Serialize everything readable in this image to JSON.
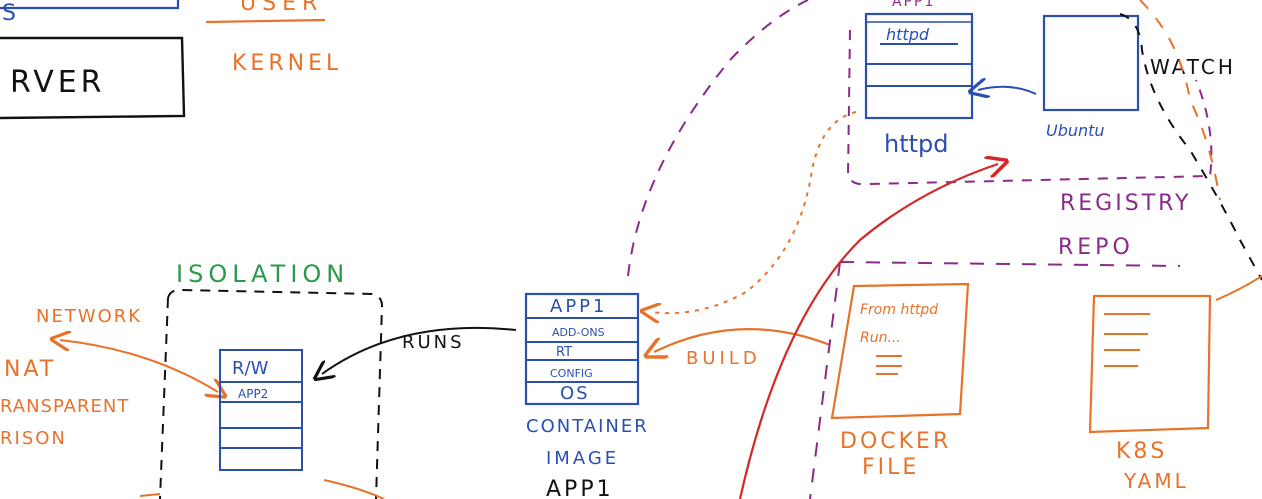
{
  "labels": {
    "user": "USER",
    "kernel": "KERNEL",
    "server": "RVER",
    "isolation": "ISOLATION",
    "network": "NETWORK",
    "nat": "NAT",
    "transparent": "RANSPARENT",
    "prison": "RISON",
    "rw": "R/W",
    "app2": "APP2",
    "runs": "RUNS",
    "build": "BUILD",
    "container_line1": "CONTAINER",
    "container_line2": "IMAGE",
    "container_app": "APP1",
    "watch": "WATCH",
    "registry": "REGISTRY",
    "repo": "REPO",
    "httpd_caption": "httpd",
    "ubuntu_caption": "Ubuntu",
    "app1_top": "APP1",
    "httpd_in_box": "httpd",
    "dockerfile_line1": "DOCKER",
    "dockerfile_line2": "FILE",
    "dockerfile_from": "From httpd",
    "dockerfile_run": "Run...",
    "k8s_line1": "K8S",
    "k8s_line2": "YAML"
  },
  "image_stack": [
    "APP1",
    "ADD-ONS",
    "RT",
    "CONFIG",
    "OS"
  ],
  "colors": {
    "blue": "#2a4fb0",
    "orange": "#e8722a",
    "purple": "#8a2a8a",
    "green": "#2a9a4a",
    "red": "#d42828",
    "black": "#111111"
  }
}
